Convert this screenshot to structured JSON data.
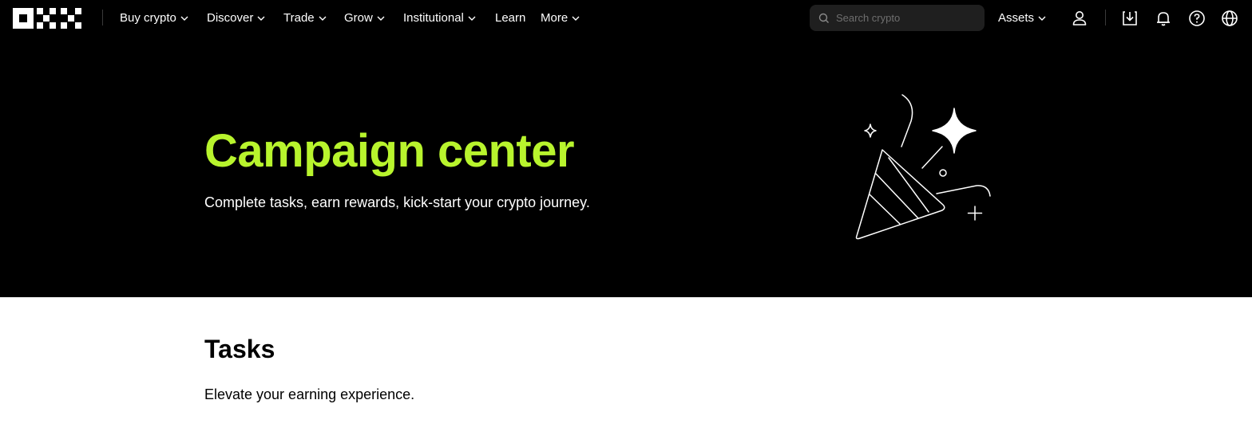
{
  "header": {
    "logo_text": "OKX",
    "nav": [
      {
        "label": "Buy crypto",
        "has_dropdown": true
      },
      {
        "label": "Discover",
        "has_dropdown": true
      },
      {
        "label": "Trade",
        "has_dropdown": true
      },
      {
        "label": "Grow",
        "has_dropdown": true
      },
      {
        "label": "Institutional",
        "has_dropdown": true
      },
      {
        "label": "Learn",
        "has_dropdown": false
      },
      {
        "label": "More",
        "has_dropdown": true
      }
    ],
    "search": {
      "placeholder": "Search crypto",
      "value": "",
      "icon": "search-icon"
    },
    "assets_label": "Assets",
    "icons": [
      "user-icon",
      "download-icon",
      "bell-icon",
      "help-icon",
      "globe-icon"
    ]
  },
  "hero": {
    "title": "Campaign center",
    "subtitle": "Complete tasks, earn rewards, kick-start your crypto journey.",
    "illustration": "party-popper-illustration",
    "title_color": "#b8f42d",
    "background": "#000000"
  },
  "tasks": {
    "title": "Tasks",
    "subtitle": "Elevate your earning experience."
  }
}
